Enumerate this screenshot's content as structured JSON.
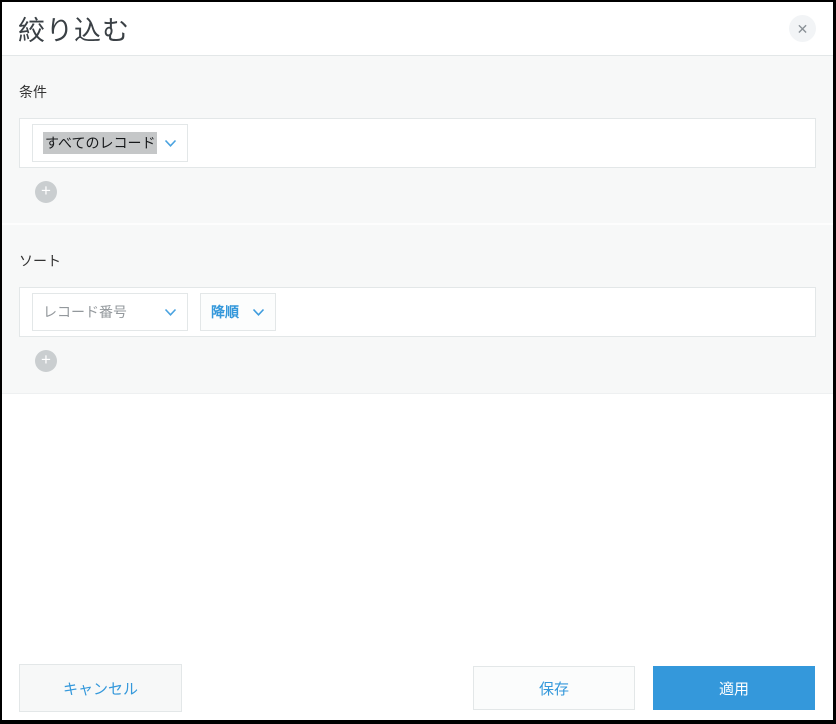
{
  "dialog": {
    "title": "絞り込む"
  },
  "icons": {
    "close": "✕",
    "plus": "+",
    "chevron_down": "chevron-down"
  },
  "condition": {
    "label": "条件",
    "record_scope_dropdown": {
      "value": "すべてのレコード",
      "selected": true
    }
  },
  "sort": {
    "label": "ソート",
    "field_dropdown": {
      "value": "レコード番号"
    },
    "order_dropdown": {
      "value": "降順"
    }
  },
  "footer": {
    "cancel": "キャンセル",
    "save": "保存",
    "apply": "適用"
  },
  "colors": {
    "accent_blue": "#3498db",
    "section_bg": "#f7f8f8",
    "border": "#e3e7e8",
    "selection_highlight": "#c5c7c8"
  }
}
